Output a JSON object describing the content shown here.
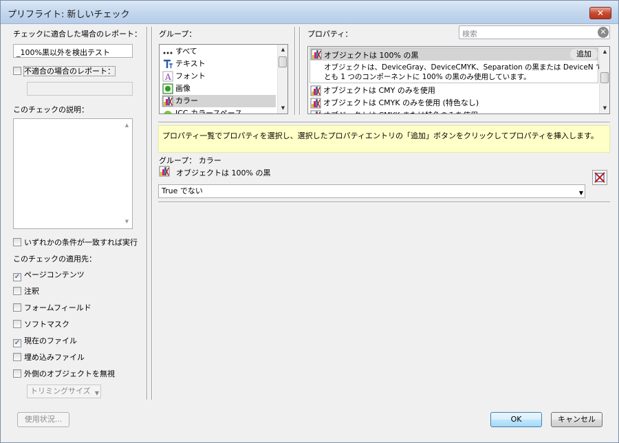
{
  "window": {
    "title": "プリフライト: 新しいチェック",
    "close_label": "✕"
  },
  "left": {
    "report_label": "チェックに適合した場合のレポート：",
    "report_value": "_100%黒以外を検出テスト",
    "noncompliant_label": "不適合の場合のレポート：",
    "noncompliant_value": "",
    "description_label": "このチェックの説明：",
    "any_condition_label": "いずれかの条件が一致すれば実行",
    "apply_to_label": "このチェックの適用先：",
    "checks": [
      {
        "label": "ページコンテンツ",
        "checked": true
      },
      {
        "label": "注釈",
        "checked": false
      },
      {
        "label": "フォームフィールド",
        "checked": false
      },
      {
        "label": "ソフトマスク",
        "checked": false
      },
      {
        "label": "現在のファイル",
        "checked": true
      },
      {
        "label": "埋め込みファイル",
        "checked": false
      },
      {
        "label": "外側のオブジェクトを無視",
        "checked": false
      }
    ],
    "trim_select": "トリミングサイズ",
    "usage_button": "使用状況..."
  },
  "groups": {
    "label": "グループ：",
    "items": [
      {
        "label": "すべて",
        "icon": "ellipsis-icon"
      },
      {
        "label": "テキスト",
        "icon": "text-icon"
      },
      {
        "label": "フォント",
        "icon": "font-icon"
      },
      {
        "label": "画像",
        "icon": "image-icon"
      },
      {
        "label": "カラー",
        "icon": "color-icon",
        "selected": true
      },
      {
        "label": "ICC カラースペース",
        "icon": "icc-icon"
      }
    ]
  },
  "properties": {
    "label": "プロパティ：",
    "search_placeholder": "検索",
    "selected_title": "オブジェクトは 100% の黒",
    "add_label": "追加",
    "selected_desc_line1": "オブジェクトは、DeviceGray、DeviceCMYK、Separation の黒または DeviceN で、少なく",
    "selected_desc_line2": "とも 1 つのコンポーネントに 100% の黒のみ使用しています。",
    "items": [
      "オブジェクトは CMY のみを使用",
      "オブジェクトは CMYK のみを使用 (特色なし)",
      "オブジェクトは CMYK または特色のみを使用"
    ]
  },
  "hint": "プロパティ一覧でプロパティを選択し、選択したプロパティエントリの「追加」ボタンをクリックしてプロパティを挿入します。",
  "condition": {
    "group_line": "グループ： カラー",
    "property": "オブジェクトは 100% の黒",
    "value": "True でない"
  },
  "footer": {
    "ok": "OK",
    "cancel": "キャンセル"
  },
  "colors": {
    "hint_bg": "#ffffc8",
    "selected_item": "#d4d4d4",
    "accent": "#3c7fb1"
  }
}
